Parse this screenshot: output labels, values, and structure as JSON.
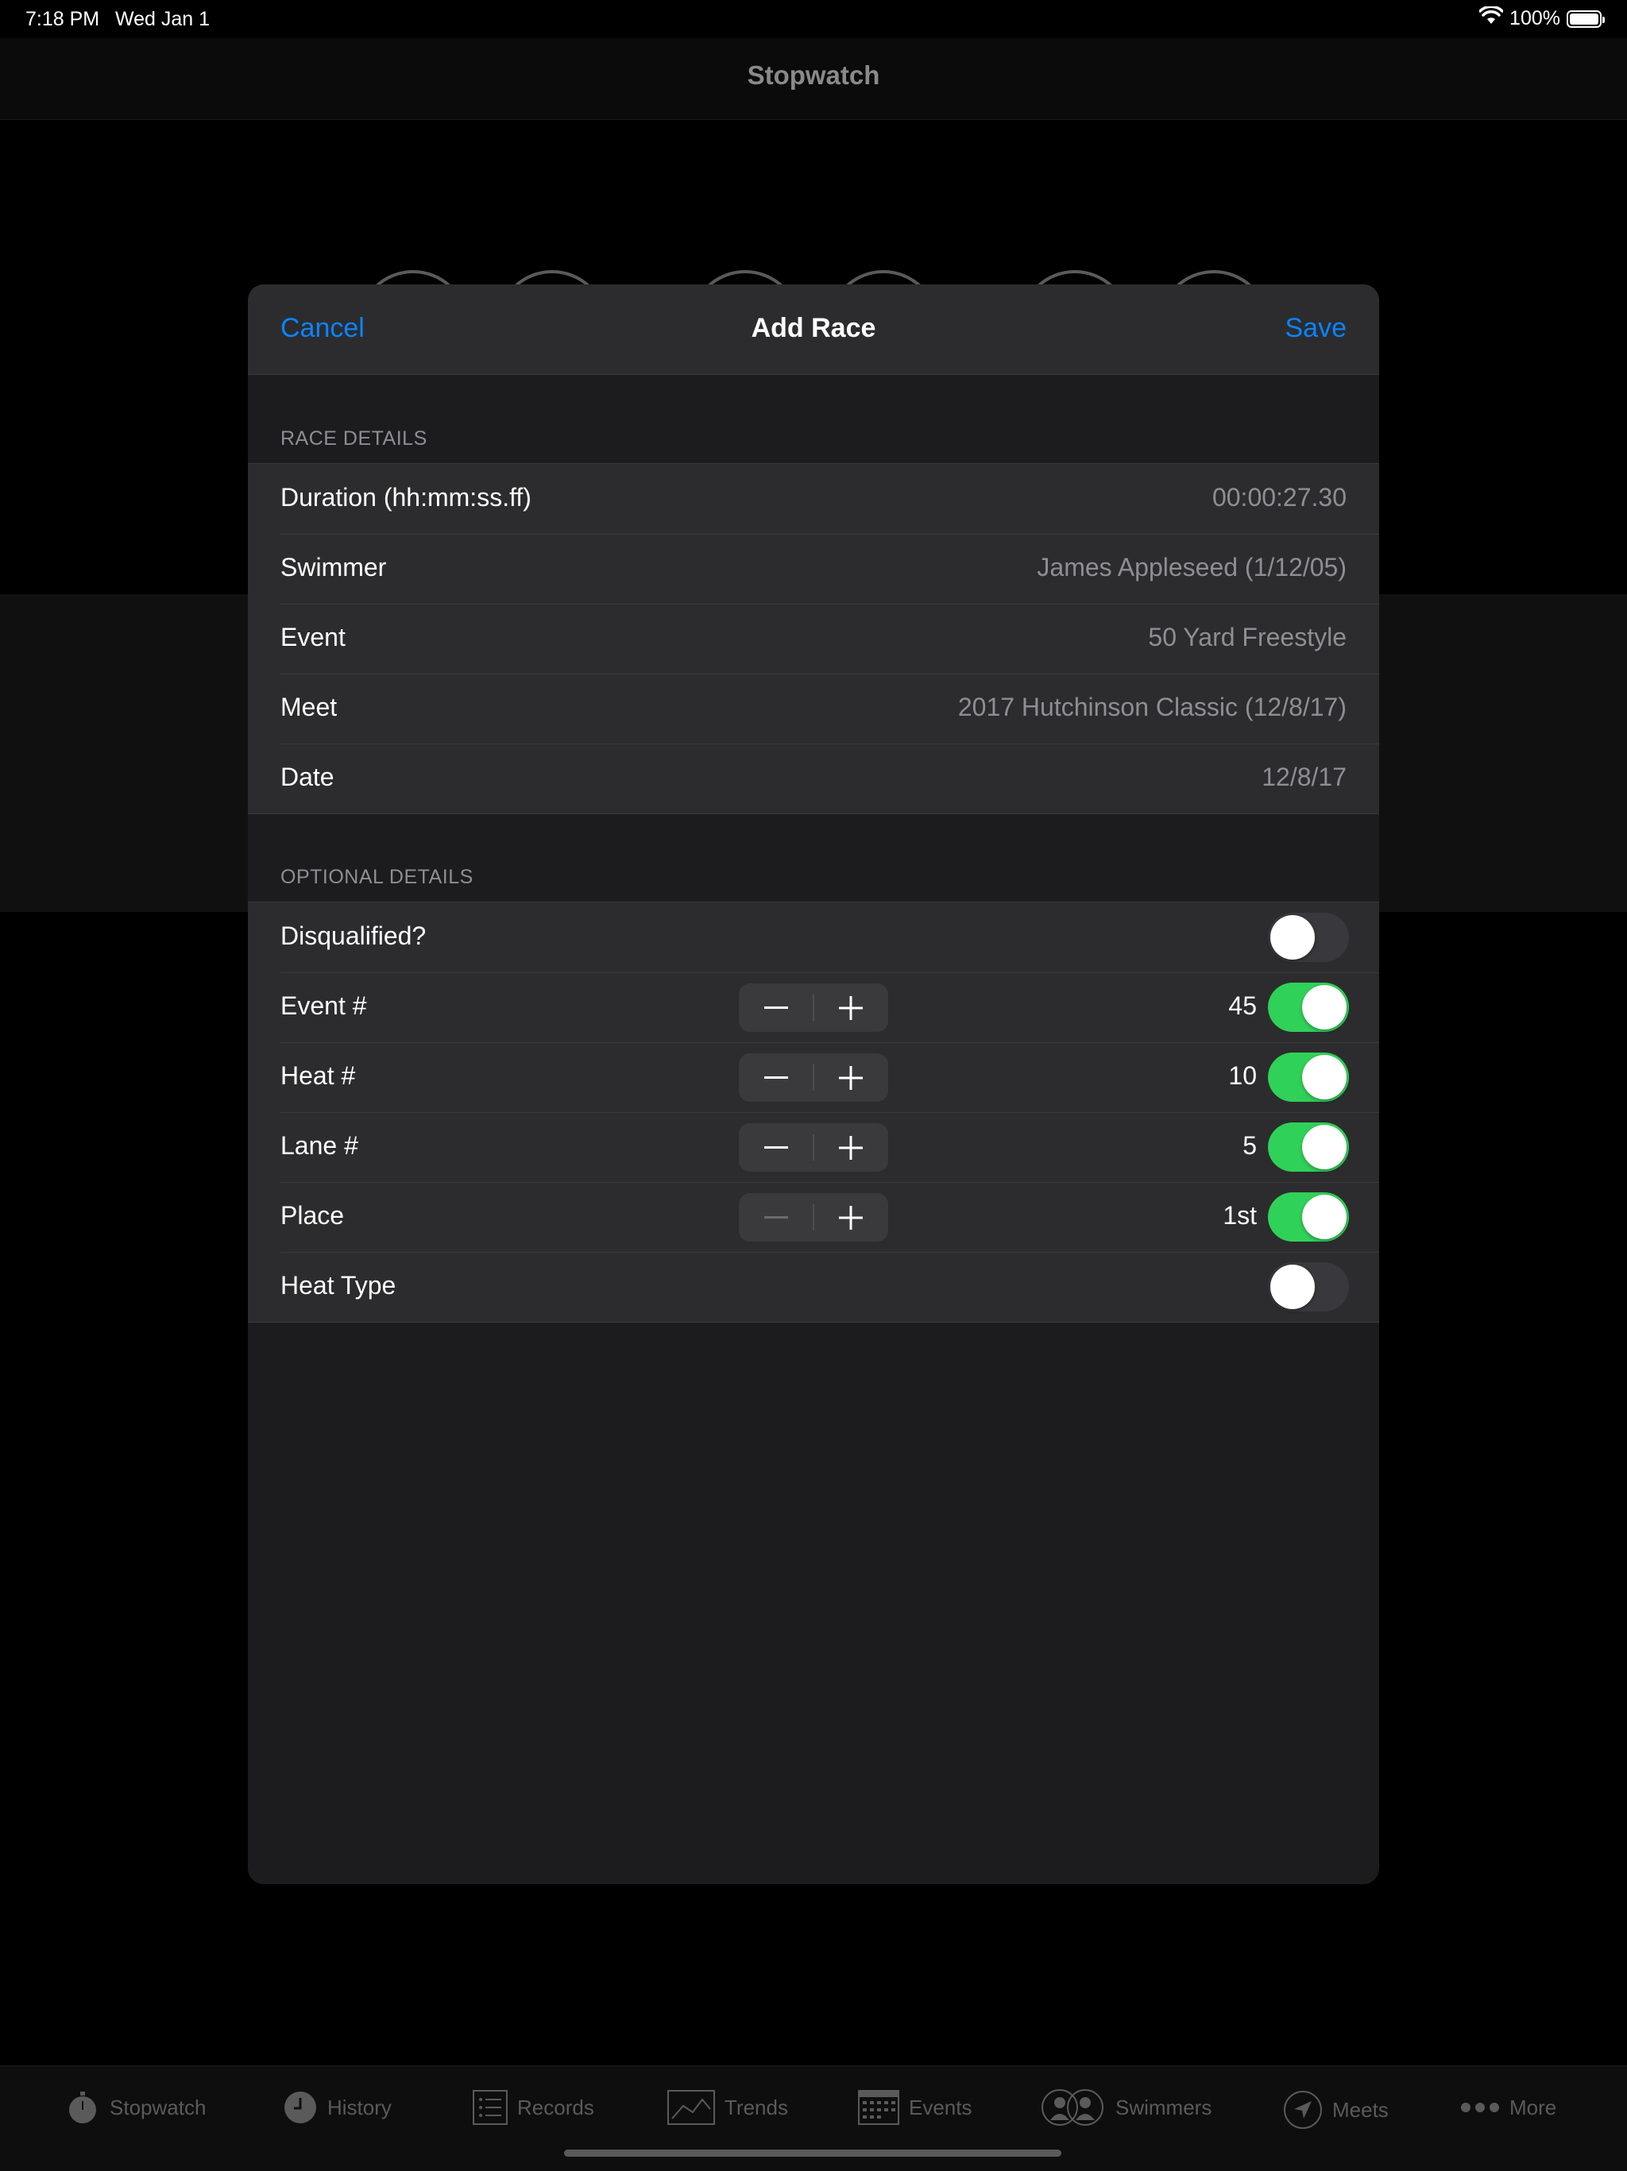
{
  "status_bar": {
    "time": "7:18 PM",
    "date": "Wed Jan 1",
    "battery": "100%"
  },
  "app": {
    "title": "Stopwatch"
  },
  "modal": {
    "title": "Add Race",
    "cancel_label": "Cancel",
    "save_label": "Save",
    "race_details": {
      "header": "RACE DETAILS",
      "rows": [
        {
          "label": "Duration (hh:mm:ss.ff)",
          "value": "00:00:27.30"
        },
        {
          "label": "Swimmer",
          "value": "James Appleseed (1/12/05)"
        },
        {
          "label": "Event",
          "value": "50 Yard Freestyle"
        },
        {
          "label": "Meet",
          "value": "2017 Hutchinson Classic (12/8/17)"
        },
        {
          "label": "Date",
          "value": "12/8/17"
        }
      ]
    },
    "optional_details": {
      "header": "OPTIONAL DETAILS",
      "rows": [
        {
          "label": "Disqualified?",
          "toggle": false
        },
        {
          "label": "Event #",
          "value": "45",
          "toggle": true,
          "stepper": true
        },
        {
          "label": "Heat #",
          "value": "10",
          "toggle": true,
          "stepper": true
        },
        {
          "label": "Lane #",
          "value": "5",
          "toggle": true,
          "stepper": true
        },
        {
          "label": "Place",
          "value": "1st",
          "toggle": true,
          "stepper": true,
          "minus_disabled": true
        },
        {
          "label": "Heat Type",
          "toggle": false
        }
      ]
    }
  },
  "tab_bar": {
    "items": [
      {
        "label": "Stopwatch",
        "icon": "stopwatch-icon"
      },
      {
        "label": "History",
        "icon": "clock-icon"
      },
      {
        "label": "Records",
        "icon": "list-icon"
      },
      {
        "label": "Trends",
        "icon": "trend-chart-icon"
      },
      {
        "label": "Events",
        "icon": "calendar-icon"
      },
      {
        "label": "Swimmers",
        "icon": "people-icon"
      },
      {
        "label": "Meets",
        "icon": "location-arrow-icon"
      },
      {
        "label": "More",
        "icon": "more-dots-icon"
      }
    ]
  },
  "colors": {
    "accent": "#0a84ff",
    "toggle_on": "#30d158",
    "modal_bg": "#1c1c1e",
    "cell_bg": "#2c2c2e"
  }
}
